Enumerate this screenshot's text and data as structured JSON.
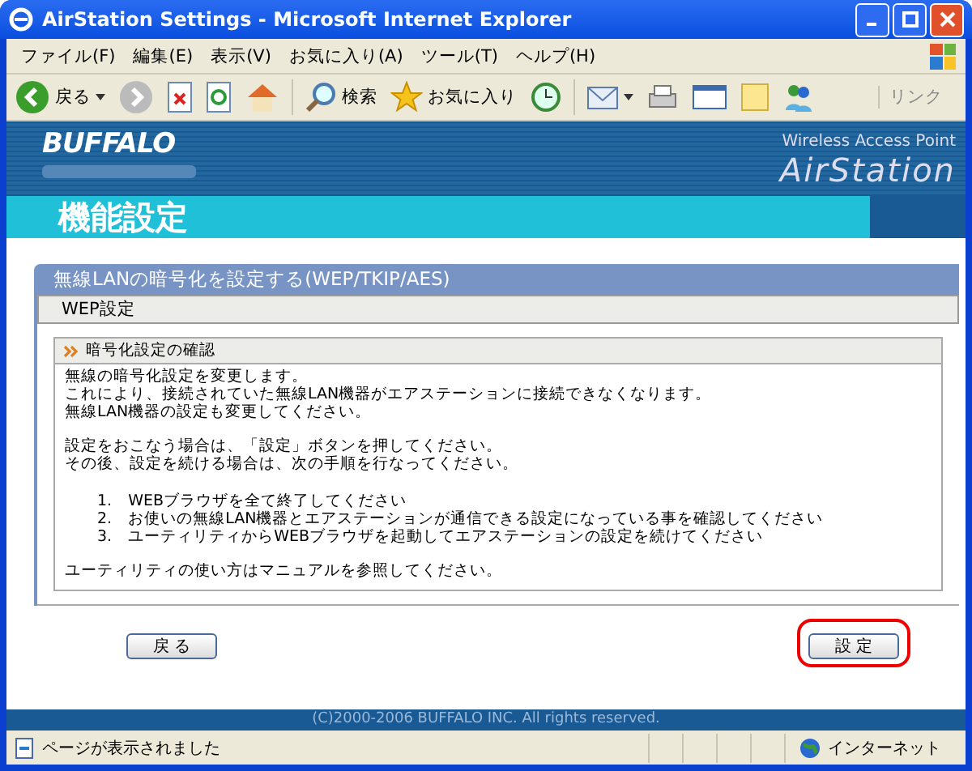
{
  "window": {
    "title": "AirStation Settings - Microsoft Internet Explorer"
  },
  "menu": [
    "ファイル(F)",
    "編集(E)",
    "表示(V)",
    "お気に入り(A)",
    "ツール(T)",
    "ヘルプ(H)"
  ],
  "toolbar": {
    "back": "戻る",
    "search": "検索",
    "favorites": "お気に入り",
    "links": "リンク"
  },
  "header": {
    "brand": "BUFFALO",
    "product_line": "Wireless Access Point",
    "product": "AirStation",
    "page_title": "機能設定"
  },
  "panel": {
    "title": "無線LANの暗号化を設定する(WEP/TKIP/AES)",
    "subtitle": "WEP設定",
    "notice_title": "暗号化設定の確認",
    "paragraphs": [
      [
        "無線の暗号化設定を変更します。",
        "これにより、接続されていた無線LAN機器がエアステーションに接続できなくなります。",
        "無線LAN機器の設定も変更してください。"
      ],
      [
        "設定をおこなう場合は、「設定」ボタンを押してください。",
        "その後、設定を続ける場合は、次の手順を行なってください。"
      ]
    ],
    "steps": [
      {
        "number": "1.",
        "text": "WEBブラウザを全て終了してください"
      },
      {
        "number": "2.",
        "text": "お使いの無線LAN機器とエアステーションが通信できる設定になっている事を確認してください"
      },
      {
        "number": "3.",
        "text": "ユーティリティからWEBブラウザを起動してエアステーションの設定を続けてください"
      }
    ],
    "closing": "ユーティリティの使い方はマニュアルを参照してください。"
  },
  "buttons": [
    {
      "label": "戻 る",
      "highlighted": false
    },
    {
      "label": "設 定",
      "highlighted": true
    }
  ],
  "copyright": "(C)2000-2006 BUFFALO INC. All rights reserved.",
  "status_bar": {
    "message": "ページが表示されました",
    "zone": "インターネット"
  }
}
